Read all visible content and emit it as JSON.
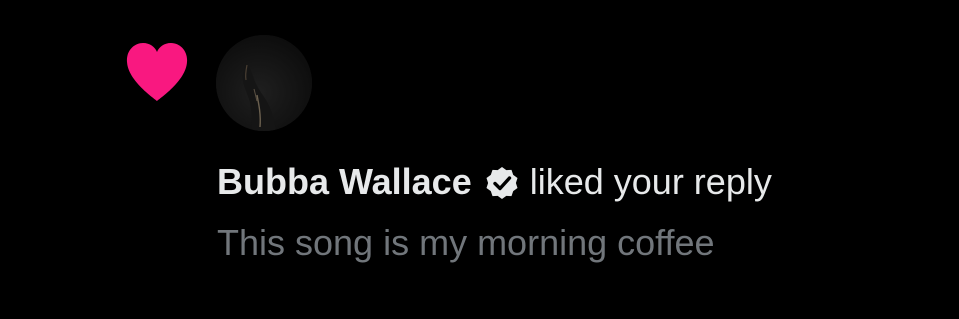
{
  "notification": {
    "type_icon": "heart-icon",
    "type_color": "#f91880",
    "user": {
      "name": "Bubba Wallace",
      "verified": true,
      "badge_icon": "verified-badge-icon",
      "avatar_icon": "avatar"
    },
    "action": "liked your reply",
    "reply_text": "This song is my morning coffee"
  },
  "colors": {
    "background": "#000000",
    "primary_text": "#e7e9ea",
    "secondary_text": "#71767b"
  }
}
